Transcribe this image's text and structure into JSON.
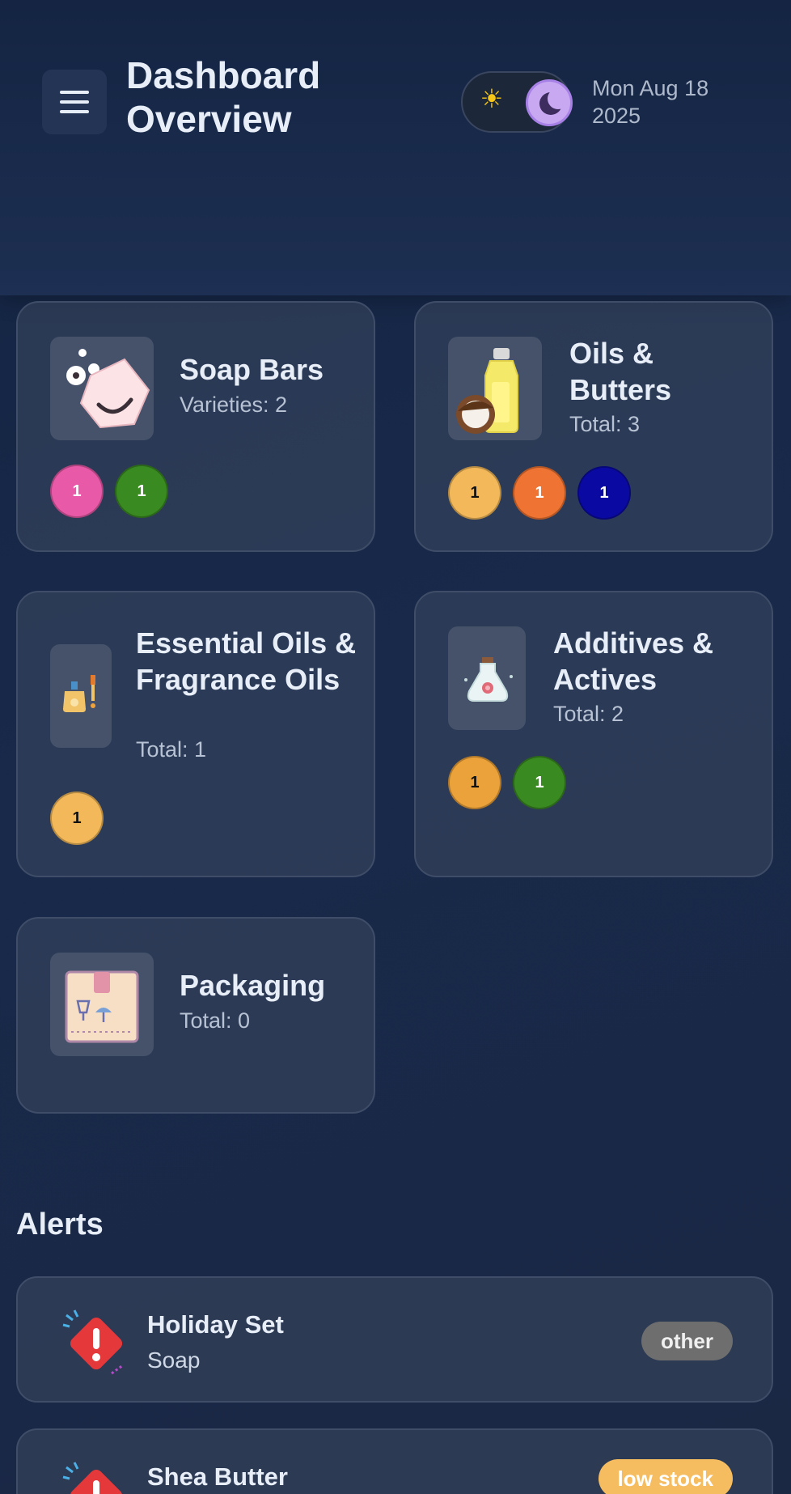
{
  "header": {
    "title": "Dashboard Overview",
    "date": "Mon Aug 18 2025",
    "icons": {
      "menu": "hamburger-menu-icon",
      "sun": "sun-icon",
      "moon": "moon-icon"
    },
    "theme_mode": "dark"
  },
  "categories": [
    {
      "title": "Soap Bars",
      "subtitle": "Varieties: 2",
      "icon": "soap-bar-icon",
      "dots": [
        {
          "label": "1",
          "color": "#e85aa8"
        },
        {
          "label": "1",
          "color": "#3a8a22"
        }
      ]
    },
    {
      "title": "Oils & Butters",
      "subtitle": "Total: 3",
      "icon": "oil-bottle-coconut-icon",
      "dots": [
        {
          "label": "1",
          "color": "#f2b85a"
        },
        {
          "label": "1",
          "color": "#ef7332"
        },
        {
          "label": "1",
          "color": "#0a0aa3"
        }
      ]
    },
    {
      "title": "Essential Oils & Fragrance Oils",
      "subtitle": "Total: 1",
      "icon": "dropper-bottle-icon",
      "dots": [
        {
          "label": "1",
          "color": "#f2b85a"
        }
      ]
    },
    {
      "title": "Additives & Actives",
      "subtitle": "Total: 2",
      "icon": "flask-flower-icon",
      "dots": [
        {
          "label": "1",
          "color": "#eba23a"
        },
        {
          "label": "1",
          "color": "#3a8a22"
        }
      ]
    },
    {
      "title": "Packaging",
      "subtitle": "Total: 0",
      "icon": "package-box-icon",
      "dots": []
    }
  ],
  "alerts": {
    "heading": "Alerts",
    "items": [
      {
        "name": "Holiday Set",
        "type": "Soap",
        "badge": "other",
        "badge_color": "#6e6e6e",
        "icon": "warning-diamond-icon"
      },
      {
        "name": "Shea Butter",
        "type": "",
        "badge": "low stock",
        "badge_color": "#f6bd60",
        "icon": "warning-diamond-icon"
      }
    ]
  }
}
